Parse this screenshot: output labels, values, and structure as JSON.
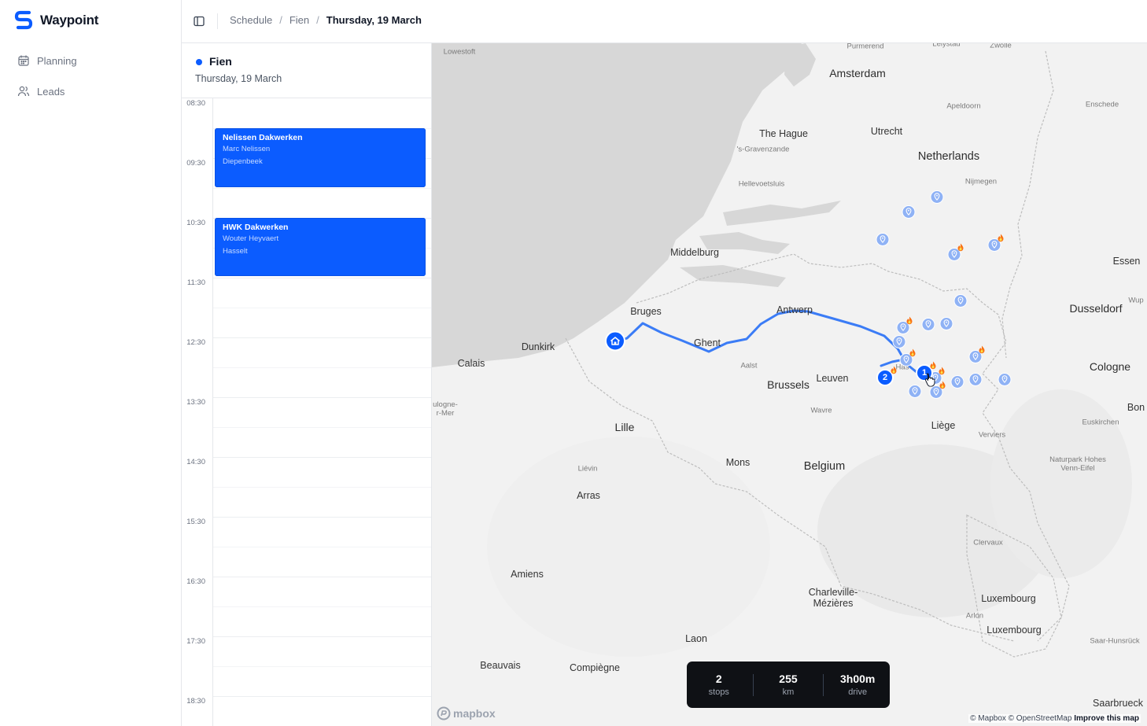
{
  "app": {
    "name": "Waypoint",
    "brand_color": "#0b5cff"
  },
  "sidebar": {
    "items": [
      {
        "label": "Planning",
        "icon": "calendar-icon"
      },
      {
        "label": "Leads",
        "icon": "users-icon"
      }
    ]
  },
  "header": {
    "breadcrumb": [
      "Schedule",
      "Fien",
      "Thursday, 19 March"
    ]
  },
  "schedule": {
    "person": "Fien",
    "date": "Thursday, 19 March",
    "times": [
      "08:30",
      "09:30",
      "10:30",
      "11:30",
      "12:30",
      "13:30",
      "14:30",
      "15:30",
      "16:30",
      "17:30",
      "18:30"
    ],
    "events": [
      {
        "title": "Nelissen Dakwerken",
        "contact": "Marc Nelissen",
        "location": "Diepenbeek"
      },
      {
        "title": "HWK Dakwerken",
        "contact": "Wouter Heyvaert",
        "location": "Hasselt"
      }
    ]
  },
  "map": {
    "labels": {
      "lowestoft": "Lowestoft",
      "purmerend": "Purmerend",
      "lelystad": "Lelystad",
      "zwolle": "Zwolle",
      "amsterdam": "Amsterdam",
      "apeldoorn": "Apeldoorn",
      "enschede": "Enschede",
      "the_hague": "The Hague",
      "utrecht": "Utrecht",
      "s_gravenzande": "'s-Gravenzande",
      "netherlands": "Netherlands",
      "hellevoetsluis": "Hellevoetsluis",
      "nijmegen": "Nijmegen",
      "middelburg": "Middelburg",
      "essen": "Essen",
      "antwerp": "Antwerp",
      "bruges": "Bruges",
      "dusseldorf": "Dusseldorf",
      "wup": "Wup",
      "dunkirk": "Dunkirk",
      "ghent": "Ghent",
      "calais": "Calais",
      "aalst": "Aalst",
      "leuven": "Leuven",
      "brussels": "Brussels",
      "hasselt": "Has",
      "cologne": "Cologne",
      "bon": "Bon",
      "boulogne": "ulogne-\nr-Mer",
      "lille": "Lille",
      "wavre": "Wavre",
      "liege": "Liège",
      "verviers": "Verviers",
      "euskirchen": "Euskirchen",
      "mons": "Mons",
      "belgium": "Belgium",
      "lievin": "Liévin",
      "naturpark": "Naturpark Hohes\nVenn-Eifel",
      "arras": "Arras",
      "clervaux": "Clervaux",
      "amiens": "Amiens",
      "charleville": "Charleville-\nMézières",
      "luxembourg_region": "Luxembourg",
      "arlon": "Arlon",
      "luxembourg_city": "Luxembourg",
      "laon": "Laon",
      "saar_hunsruck": "Saar-Hunsrück",
      "beauvais": "Beauvais",
      "compiegne": "Compiègne",
      "saarbrueck": "Saarbrueck"
    },
    "route_color": "#3b7cf6",
    "stop_labels": [
      "1",
      "2"
    ],
    "stats": [
      {
        "value": "2",
        "label": "stops"
      },
      {
        "value": "255",
        "label": "km"
      },
      {
        "value": "3h00m",
        "label": "drive"
      }
    ],
    "logo": "mapbox",
    "attribution": {
      "text": "© Mapbox © OpenStreetMap",
      "link": "Improve this map"
    }
  }
}
